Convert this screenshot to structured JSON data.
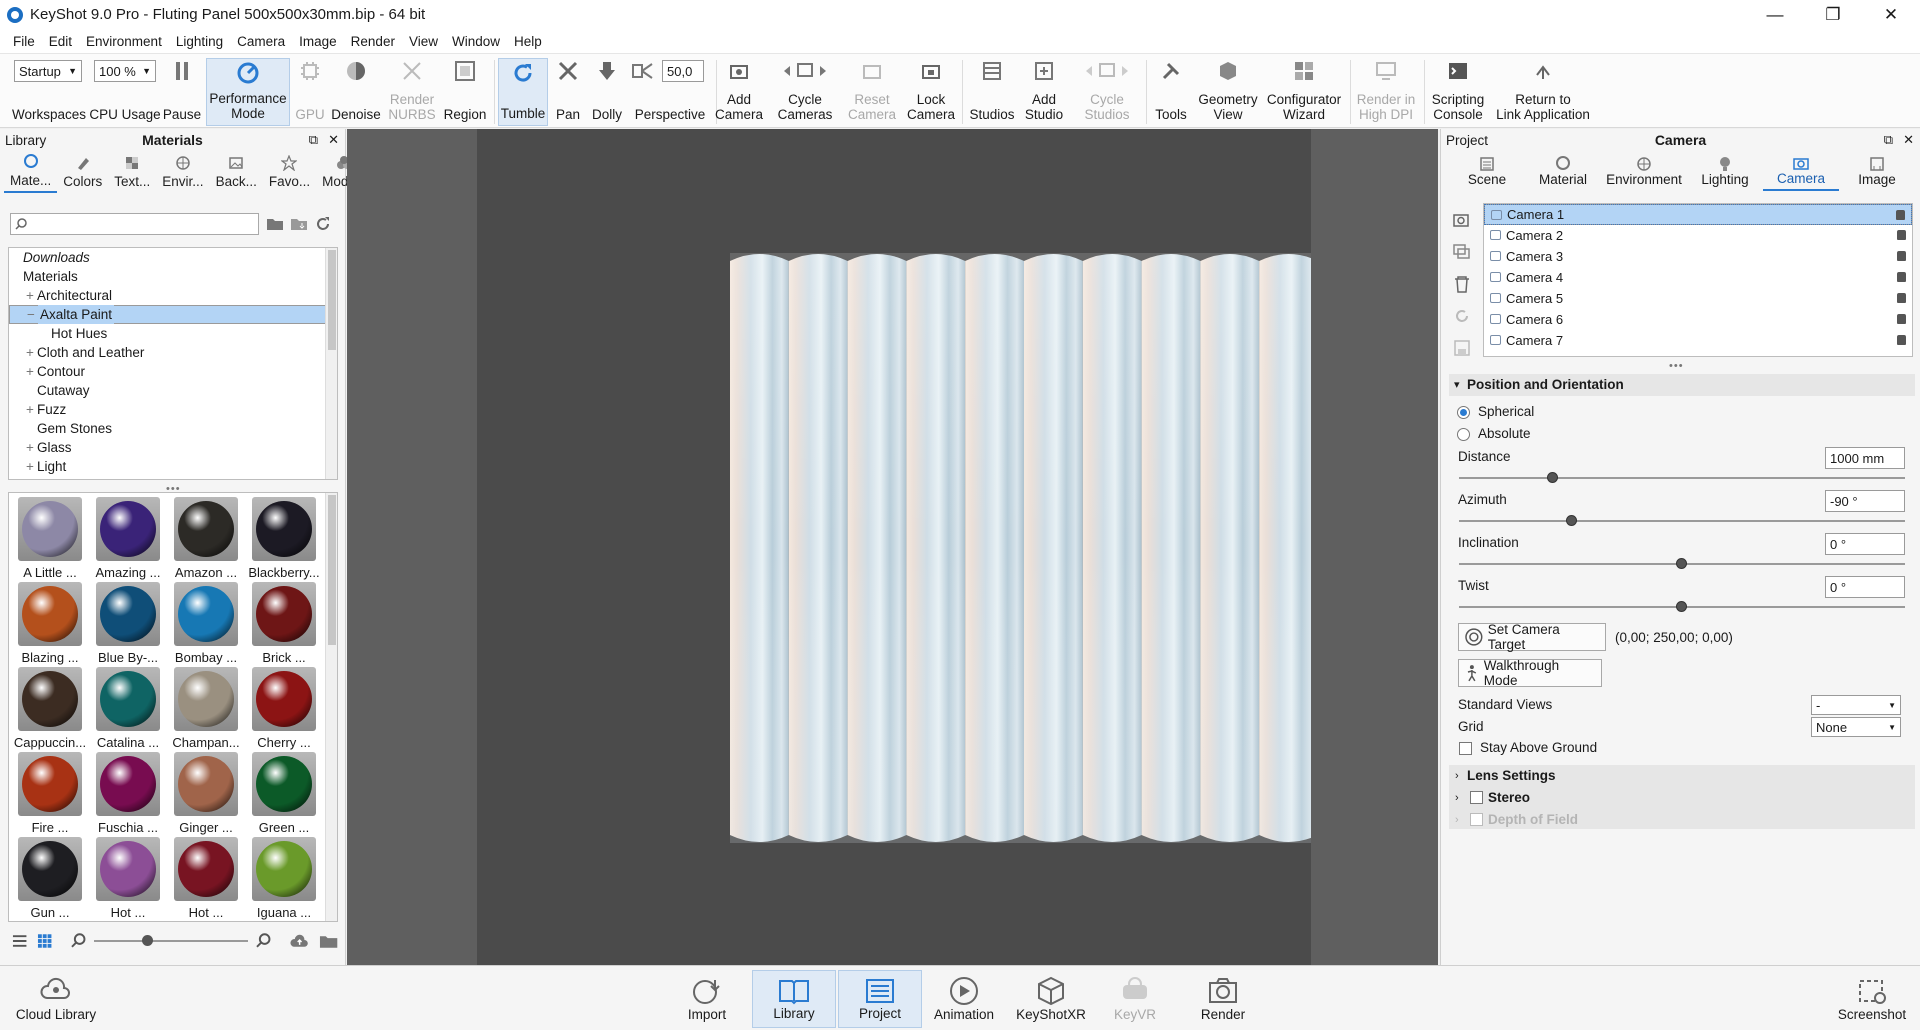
{
  "window": {
    "title": "KeyShot 9.0 Pro  - Fluting Panel 500x500x30mm.bip  - 64 bit",
    "minimize": "—",
    "restore": "❐",
    "close": "✕"
  },
  "menu": [
    "File",
    "Edit",
    "Environment",
    "Lighting",
    "Camera",
    "Image",
    "Render",
    "View",
    "Window",
    "Help"
  ],
  "ribbon": {
    "workspace_value": "Startup",
    "workspace_label": "Workspaces",
    "cpu_value": "100 %",
    "cpu_label": "CPU Usage",
    "pause": "Pause",
    "perf_mode_1": "Performance",
    "perf_mode_2": "Mode",
    "gpu": "GPU",
    "denoise": "Denoise",
    "render_nurbs_1": "Render",
    "render_nurbs_2": "NURBS",
    "region": "Region",
    "tumble": "Tumble",
    "pan": "Pan",
    "dolly": "Dolly",
    "fov_value": "50,0",
    "perspective": "Perspective",
    "add_camera_1": "Add",
    "add_camera_2": "Camera",
    "cycle_cameras_1": "Cycle",
    "cycle_cameras_2": "Cameras",
    "reset_camera_1": "Reset",
    "reset_camera_2": "Camera",
    "lock_camera_1": "Lock",
    "lock_camera_2": "Camera",
    "studios": "Studios",
    "add_studio_1": "Add",
    "add_studio_2": "Studio",
    "cycle_studios_1": "Cycle",
    "cycle_studios_2": "Studios",
    "tools": "Tools",
    "geometry_view_1": "Geometry",
    "geometry_view_2": "View",
    "configurator_1": "Configurator",
    "configurator_2": "Wizard",
    "high_dpi_1": "Render in",
    "high_dpi_2": "High DPI",
    "scripting_1": "Scripting",
    "scripting_2": "Console",
    "return_1": "Return to",
    "return_2": "Link Application"
  },
  "library": {
    "panel_label": "Library",
    "title": "Materials",
    "tabs": [
      "Mate...",
      "Colors",
      "Text...",
      "Envir...",
      "Back...",
      "Favo...",
      "Models"
    ],
    "tree": [
      {
        "label": "Downloads",
        "level": 0,
        "italic": true,
        "exp": ""
      },
      {
        "label": "Materials",
        "level": 0,
        "exp": ""
      },
      {
        "label": "Architectural",
        "level": 1,
        "exp": "+"
      },
      {
        "label": "Axalta Paint",
        "level": 1,
        "exp": "−",
        "selected": true
      },
      {
        "label": "Hot Hues",
        "level": 2,
        "exp": ""
      },
      {
        "label": "Cloth and Leather",
        "level": 1,
        "exp": "+"
      },
      {
        "label": "Contour",
        "level": 1,
        "exp": "+"
      },
      {
        "label": "Cutaway",
        "level": 1,
        "exp": ""
      },
      {
        "label": "Fuzz",
        "level": 1,
        "exp": "+"
      },
      {
        "label": "Gem Stones",
        "level": 1,
        "exp": ""
      },
      {
        "label": "Glass",
        "level": 1,
        "exp": "+"
      },
      {
        "label": "Light",
        "level": 1,
        "exp": "+"
      }
    ],
    "materials": [
      {
        "label": "A Little ...",
        "color": "#8d88a6"
      },
      {
        "label": "Amazing ...",
        "color": "#3a2378"
      },
      {
        "label": "Amazon ...",
        "color": "#2c2a26"
      },
      {
        "label": "Blackberry...",
        "color": "#1c1a24"
      },
      {
        "label": "Blazing ...",
        "color": "#b4501c"
      },
      {
        "label": "Blue By-...",
        "color": "#0f4e78"
      },
      {
        "label": "Bombay ...",
        "color": "#1778b4"
      },
      {
        "label": "Brick ...",
        "color": "#6e1616"
      },
      {
        "label": "Cappuccin...",
        "color": "#3c2c22"
      },
      {
        "label": "Catalina ...",
        "color": "#0f6464"
      },
      {
        "label": "Champan...",
        "color": "#9a9080"
      },
      {
        "label": "Cherry ...",
        "color": "#8c1414"
      },
      {
        "label": "Fire ...",
        "color": "#a83214"
      },
      {
        "label": "Fuschia ...",
        "color": "#780c50"
      },
      {
        "label": "Ginger ...",
        "color": "#a0644a"
      },
      {
        "label": "Green ...",
        "color": "#0c5a28"
      },
      {
        "label": "Gun ...",
        "color": "#1e1e22"
      },
      {
        "label": "Hot ...",
        "color": "#8c4e96"
      },
      {
        "label": "Hot ...",
        "color": "#781422"
      },
      {
        "label": "Iguana ...",
        "color": "#6a9a2a"
      }
    ]
  },
  "project": {
    "panel_label": "Project",
    "title": "Camera",
    "tabs": [
      "Scene",
      "Material",
      "Environment",
      "Lighting",
      "Camera",
      "Image"
    ],
    "active_tab": "Camera",
    "cameras": [
      "Camera 1",
      "Camera 2",
      "Camera 3",
      "Camera 4",
      "Camera 5",
      "Camera 6",
      "Camera 7"
    ],
    "pos_section": "Position and Orientation",
    "spherical": "Spherical",
    "absolute": "Absolute",
    "distance_label": "Distance",
    "distance_value": "1000 mm",
    "azimuth_label": "Azimuth",
    "azimuth_value": "-90 °",
    "inclination_label": "Inclination",
    "inclination_value": "0 °",
    "twist_label": "Twist",
    "twist_value": "0 °",
    "set_target": "Set Camera Target",
    "target_coords": "(0,00; 250,00; 0,00)",
    "walkthrough": "Walkthrough Mode",
    "standard_views_label": "Standard Views",
    "standard_views_value": "-",
    "grid_label": "Grid",
    "grid_value": "None",
    "stay_above": "Stay Above Ground",
    "lens_settings": "Lens Settings",
    "stereo": "Stereo",
    "dof": "Depth of Field"
  },
  "bottom": {
    "cloud_library": "Cloud Library",
    "import": "Import",
    "library": "Library",
    "project": "Project",
    "animation": "Animation",
    "keyshotxr": "KeyShotXR",
    "keyvr": "KeyVR",
    "render": "Render",
    "screenshot": "Screenshot"
  }
}
